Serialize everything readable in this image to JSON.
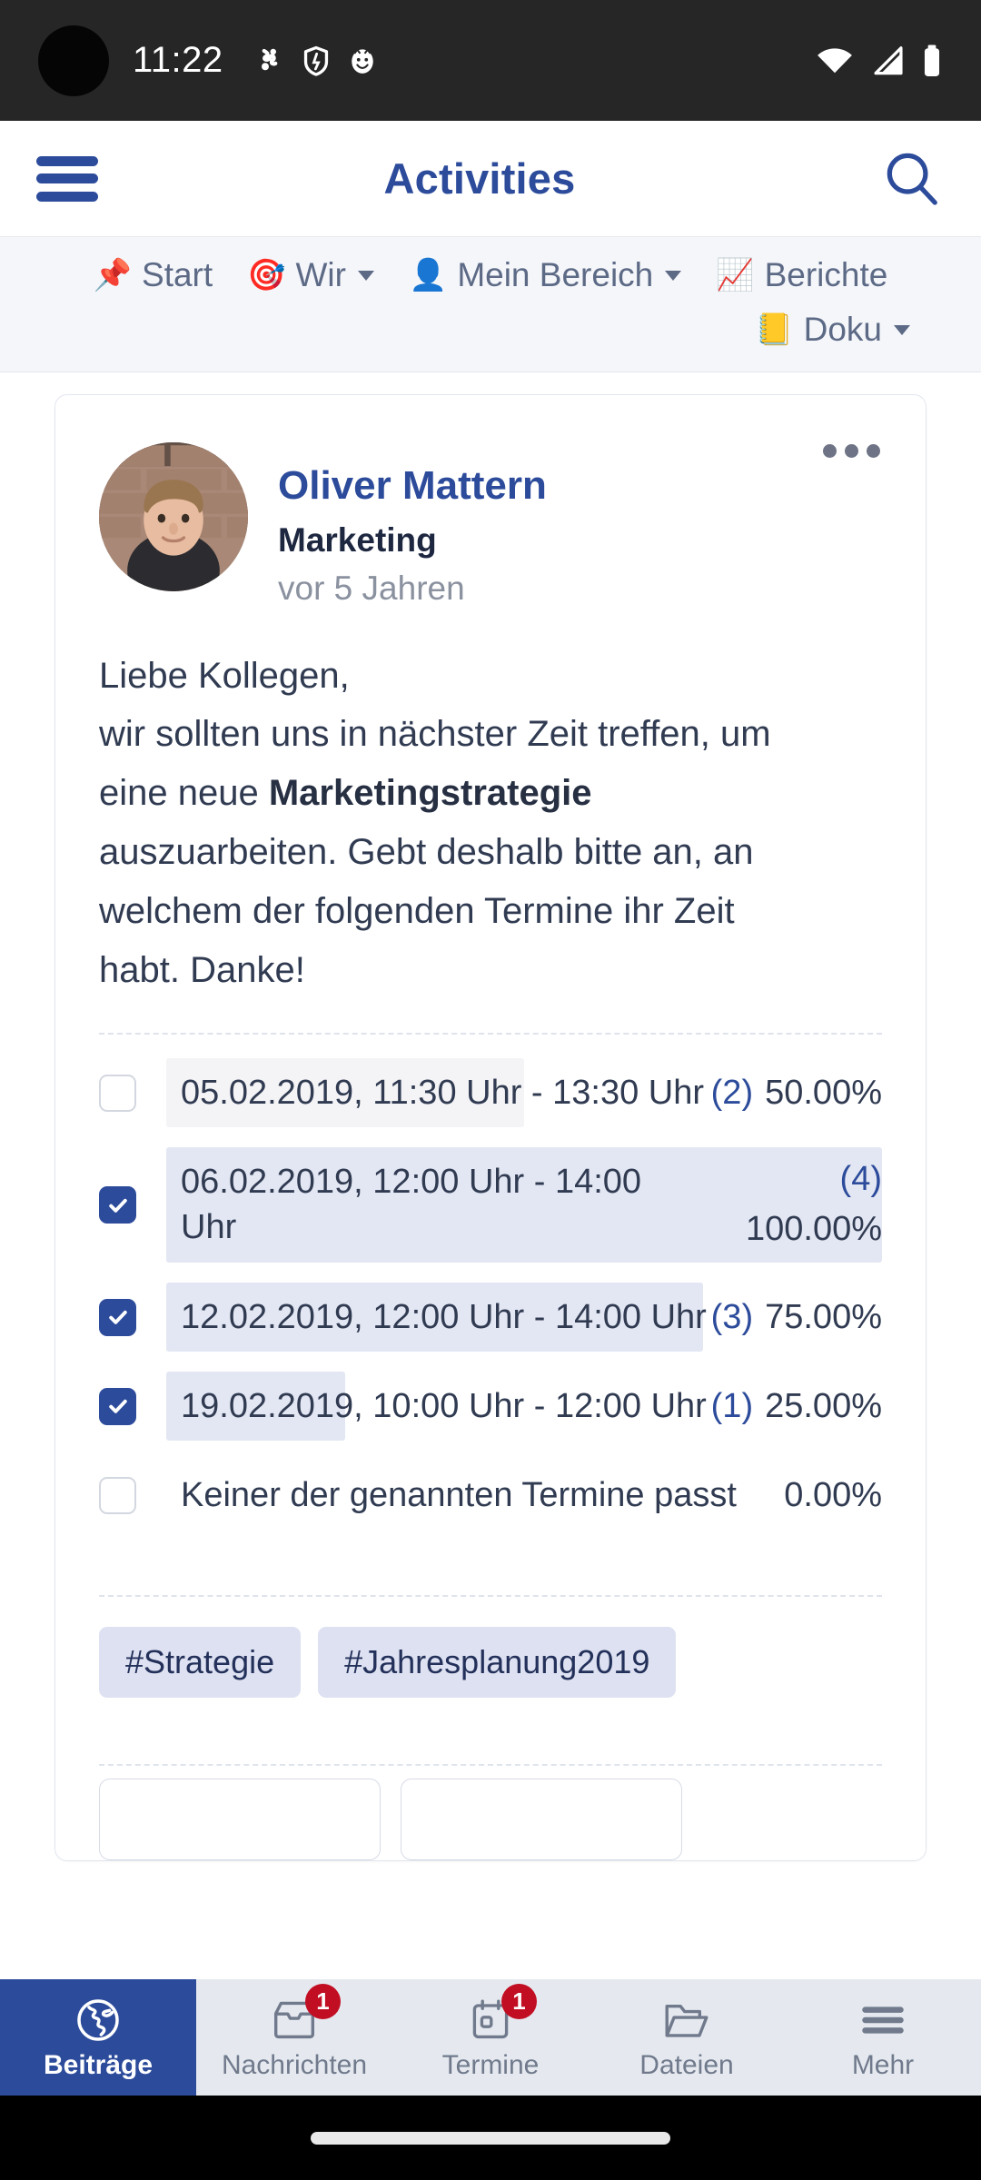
{
  "status_bar": {
    "time": "11:22",
    "left_icons": [
      "bluetooth-share-icon",
      "shield-icon",
      "app-notification-icon"
    ],
    "right_icons": [
      "wifi-icon",
      "cellular-signal-icon",
      "battery-icon"
    ],
    "background": "#262626"
  },
  "app_bar": {
    "menu_icon": "hamburger-menu-icon",
    "title": "Activities",
    "search_icon": "search-icon",
    "accent_color": "#2c4b9b"
  },
  "nav_strip": {
    "items": [
      {
        "emoji": "📌",
        "label": "Start",
        "icon_name": "pushpin-icon",
        "has_caret": false
      },
      {
        "emoji": "🎯",
        "label": "Wir",
        "icon_name": "target-icon",
        "has_caret": true
      },
      {
        "emoji": "👤",
        "label": "Mein Bereich",
        "icon_name": "person-icon",
        "has_caret": true
      },
      {
        "emoji": "📈",
        "label": "Berichte",
        "icon_name": "chart-increasing-icon",
        "has_caret": false
      },
      {
        "emoji": "📒",
        "label": "Doku",
        "icon_name": "ledger-icon",
        "has_caret": true
      }
    ]
  },
  "post": {
    "avatar_name": "avatar",
    "author": "Oliver Mattern",
    "department": "Marketing",
    "timestamp": "vor 5 Jahren",
    "more_icon": "more-options-icon",
    "body": {
      "line1": "Liebe Kollegen,",
      "line2": "wir sollten uns in nächster Zeit treffen, um",
      "line3_prefix": "eine neue ",
      "line3_bold": "Marketingstrategie",
      "line4": "auszuarbeiten. Gebt deshalb bitte an, an",
      "line5": "welchem der folgenden Termine ihr Zeit",
      "line6": "habt. Danke!"
    },
    "poll": {
      "options": [
        {
          "label": "05.02.2019, 11:30 Uhr - 13:30 Uhr",
          "count": "(2)",
          "percent_label": "50.00%",
          "percent": 50,
          "checked": false
        },
        {
          "label": "06.02.2019, 12:00 Uhr - 14:00 Uhr",
          "count": "(4)",
          "percent_label": "100.00%",
          "percent": 100,
          "checked": true
        },
        {
          "label": "12.02.2019, 12:00 Uhr - 14:00 Uhr",
          "count": "(3)",
          "percent_label": "75.00%",
          "percent": 75,
          "checked": true
        },
        {
          "label": "19.02.2019, 10:00 Uhr - 12:00 Uhr",
          "count": "(1)",
          "percent_label": "25.00%",
          "percent": 25,
          "checked": true
        },
        {
          "label": "Keiner der genannten Termine passt",
          "count": "",
          "percent_label": "0.00%",
          "percent": 0,
          "checked": false
        }
      ]
    },
    "tags": [
      "#Strategie",
      "#Jahresplanung2019"
    ]
  },
  "bottom_nav": {
    "items": [
      {
        "label": "Beiträge",
        "icon_name": "globe-icon",
        "active": true,
        "badge": ""
      },
      {
        "label": "Nachrichten",
        "icon_name": "inbox-icon",
        "active": false,
        "badge": "1"
      },
      {
        "label": "Termine",
        "icon_name": "calendar-icon",
        "active": false,
        "badge": "1"
      },
      {
        "label": "Dateien",
        "icon_name": "folder-icon",
        "active": false,
        "badge": ""
      },
      {
        "label": "Mehr",
        "icon_name": "hamburger-menu-icon",
        "active": false,
        "badge": ""
      }
    ],
    "active_color": "#2c4b9b",
    "badge_color": "#c20e23"
  },
  "gesture_bar": {
    "icon_name": "home-gesture-pill"
  }
}
